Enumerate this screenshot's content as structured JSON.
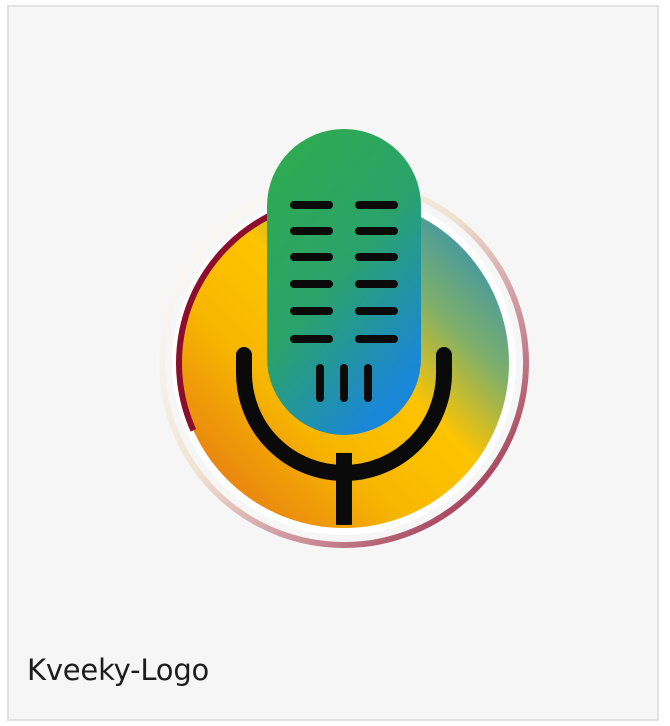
{
  "card": {
    "caption": "Kveeky-Logo"
  },
  "logo": {
    "icon": "microphone-icon",
    "colors": {
      "ring_gradient": [
        "#e48a1a",
        "#ffc400",
        "#1e8fd4"
      ],
      "ring_border": "#8c0d2e",
      "mic_gradient": [
        "#2fb04a",
        "#1e88d6"
      ],
      "stand": "#0a0a0a",
      "card_background": "#f6f6f6"
    }
  }
}
